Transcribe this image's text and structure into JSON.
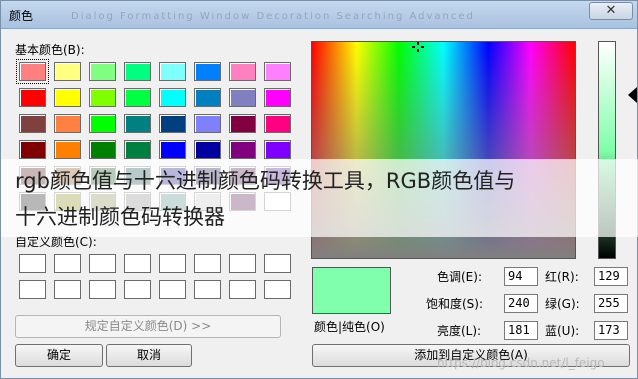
{
  "window": {
    "title": "颜色",
    "ghost_text": "Dialog Formatting  Window Decoration  Searching  Advanced",
    "close_glyph": "✕"
  },
  "basic": {
    "label": "基本颜色(B):",
    "colors": [
      "#ff8080",
      "#ffff80",
      "#80ff80",
      "#00ff80",
      "#80ffff",
      "#0080ff",
      "#ff80c0",
      "#ff80ff",
      "#ff0000",
      "#ffff00",
      "#80ff00",
      "#00ff40",
      "#00ffff",
      "#0080c0",
      "#8080c0",
      "#ff00ff",
      "#804040",
      "#ff8040",
      "#00ff00",
      "#008080",
      "#004080",
      "#8080ff",
      "#800040",
      "#ff0080",
      "#800000",
      "#ff8000",
      "#008000",
      "#008040",
      "#0000ff",
      "#0000a0",
      "#800080",
      "#8000ff",
      "#400000",
      "#804000",
      "#004000",
      "#004040",
      "#000080",
      "#000040",
      "#400040",
      "#400080",
      "#000000",
      "#808000",
      "#808040",
      "#808080",
      "#408080",
      "#c0c0c0",
      "#400040",
      "#ffffff"
    ]
  },
  "custom": {
    "label": "自定义颜色(C):",
    "count": 16
  },
  "buttons": {
    "define_custom": "规定自定义颜色(D) >>",
    "ok": "确定",
    "cancel": "取消",
    "add_custom": "添加到自定义颜色(A)"
  },
  "preview": {
    "label": "颜色|纯色(O)",
    "color": "#80ffad"
  },
  "fields": {
    "hue_label": "色调(E):",
    "hue": "94",
    "sat_label": "饱和度(S):",
    "sat": "240",
    "lum_label": "亮度(L):",
    "lum": "181",
    "red_label": "红(R):",
    "red": "129",
    "green_label": "绿(G):",
    "green": "255",
    "blue_label": "蓝(U):",
    "blue": "173"
  },
  "overlay": {
    "line1": "rgb颜色值与十六进制颜色码转换工具，RGB颜色值与",
    "line2": "十六进制颜色码转换器"
  },
  "watermark": "https://blog.csdn.net/l_feigo"
}
